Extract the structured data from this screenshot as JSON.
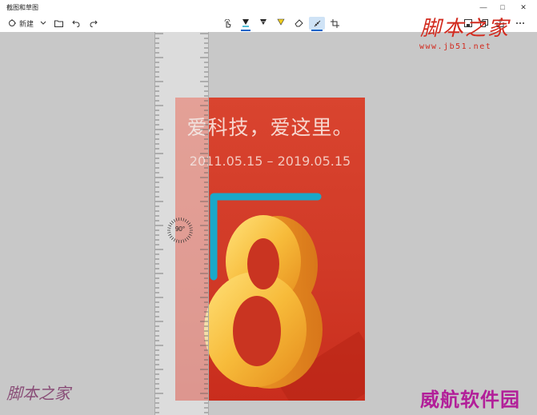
{
  "window": {
    "title": "截图和草图",
    "controls": {
      "minimize": "—",
      "maximize": "□",
      "close": "✕"
    }
  },
  "toolbar": {
    "new_label": "新建",
    "tools": [
      "touch-writing",
      "ballpoint-pen",
      "pencil",
      "highlighter",
      "eraser",
      "ruler",
      "crop"
    ],
    "right_actions": [
      "save",
      "copy",
      "share",
      "more"
    ]
  },
  "poster": {
    "headline": "爱科技，爱这里。",
    "date_range": "2011.05.15 – 2019.05.15",
    "big_number": "8"
  },
  "ruler": {
    "angle": "90°"
  },
  "colors": {
    "poster_red": "#d13a27",
    "number_gold": "#f5b335",
    "ink_cyan": "#1aa8c9",
    "accent_blue": "#0a64c8"
  },
  "watermarks": {
    "top_right_logo": "脚本之家",
    "top_right_url": "www.jb51.net",
    "bottom_left": "脚本之家",
    "bottom_right": "威航软件园"
  }
}
